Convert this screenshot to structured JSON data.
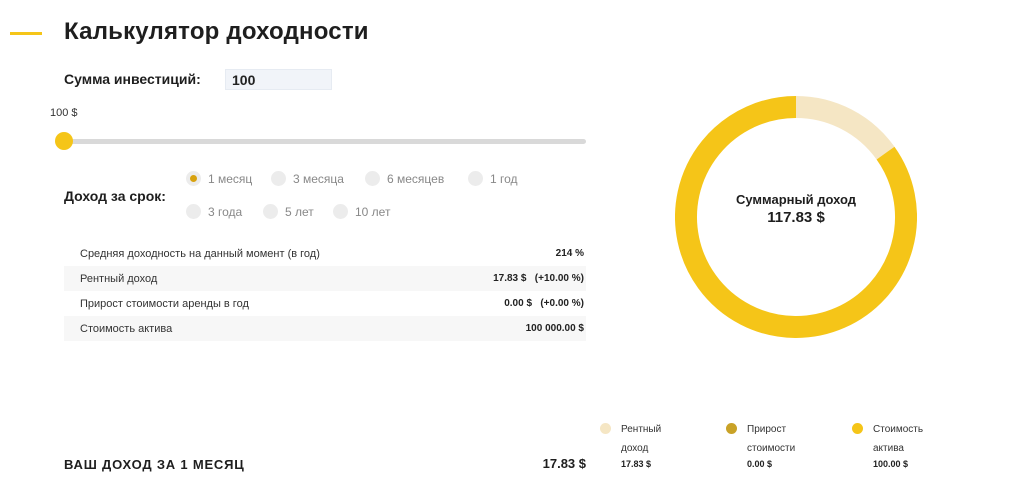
{
  "header": {
    "title": "Калькулятор доходности"
  },
  "investment": {
    "label": "Сумма инвестиций:",
    "value": "100"
  },
  "slider": {
    "value_label": "100 $",
    "level_percent": 0
  },
  "period": {
    "label": "Доход за срок:",
    "options": [
      "1 месяц",
      "3 месяца",
      "6 месяцев",
      "1 год",
      "3 года",
      "5 лет",
      "10 лет"
    ],
    "selected": "1 месяц"
  },
  "stats": [
    {
      "label": "Средняя доходность на данный момент (в год)",
      "value": "214 %"
    },
    {
      "label": "Рентный доход",
      "value": "17.83 $   (+10.00 %)"
    },
    {
      "label": "Прирост стоимости аренды в год",
      "value": "0.00 $   (+0.00 %)"
    },
    {
      "label": "Стоимость актива",
      "value": "100 000.00 $"
    }
  ],
  "total": {
    "label": "ВАШ ДОХОД ЗА  1 МЕСЯЦ",
    "value": "17.83 $"
  },
  "chart_data": {
    "type": "pie",
    "title": "Суммарный доход",
    "center_value": "117.83 $",
    "categories": [
      "Рентный доход",
      "Прирост стоимости",
      "Стоимость актива"
    ],
    "values": [
      17.83,
      0.0,
      100.0
    ],
    "colors": [
      "#f5e6c4",
      "#c9a227",
      "#f5c518"
    ]
  },
  "legend": [
    {
      "label": "Рентный доход",
      "value": "17.83 $",
      "color": "#f5e6c4"
    },
    {
      "label": "Прирост стоимости",
      "value": "0.00 $",
      "color": "#c9a227"
    },
    {
      "label": "Стоимость актива",
      "value": "100.00 $",
      "color": "#f5c518"
    }
  ],
  "colors": {
    "accent": "#f5c518",
    "radio_checked": "#d8a20f",
    "track": "#d9d9d9"
  }
}
